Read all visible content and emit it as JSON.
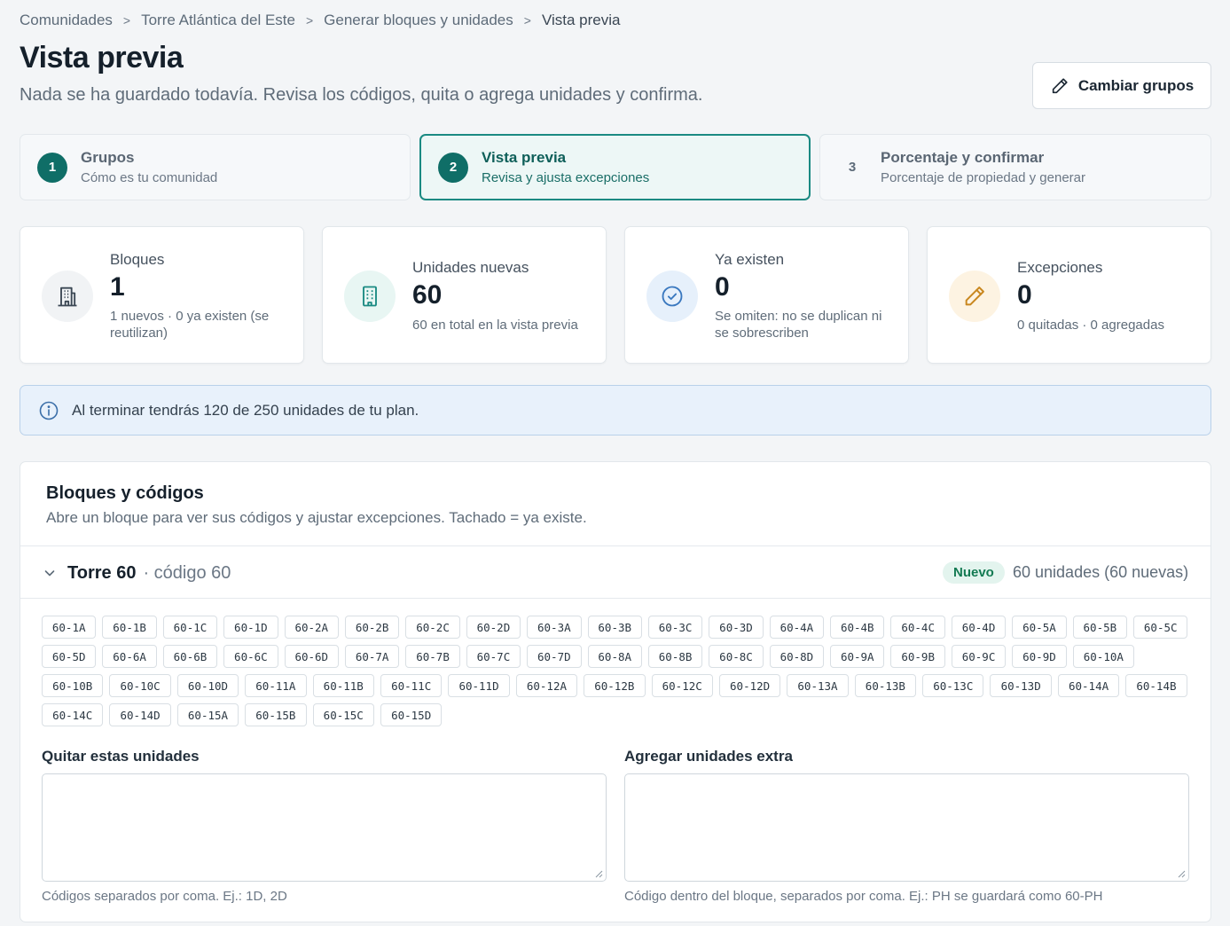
{
  "breadcrumb": [
    "Comunidades",
    "Torre Atlántica del Este",
    "Generar bloques y unidades",
    "Vista previa"
  ],
  "header": {
    "title": "Vista previa",
    "subtitle": "Nada se ha guardado todavía. Revisa los códigos, quita o agrega unidades y confirma.",
    "change_groups_label": "Cambiar grupos"
  },
  "steps": [
    {
      "num": "1",
      "title": "Grupos",
      "sub": "Cómo es tu comunidad"
    },
    {
      "num": "2",
      "title": "Vista previa",
      "sub": "Revisa y ajusta excepciones"
    },
    {
      "num": "3",
      "title": "Porcentaje y confirmar",
      "sub": "Porcentaje de propiedad y generar"
    }
  ],
  "stats": [
    {
      "label": "Bloques",
      "value": "1",
      "desc": "1 nuevos · 0 ya existen (se reutilizan)",
      "icon": "building-icon"
    },
    {
      "label": "Unidades nuevas",
      "value": "60",
      "desc": "60 en total en la vista previa",
      "icon": "apartment-icon"
    },
    {
      "label": "Ya existen",
      "value": "0",
      "desc": "Se omiten: no se duplican ni se sobrescriben",
      "icon": "check-circle-icon"
    },
    {
      "label": "Excepciones",
      "value": "0",
      "desc": "0 quitadas · 0 agregadas",
      "icon": "pencil-icon"
    }
  ],
  "info_banner": "Al terminar tendrás 120 de 250 unidades de tu plan.",
  "blocks_panel": {
    "title": "Bloques y códigos",
    "subtitle": "Abre un bloque para ver sus códigos y ajustar excepciones. Tachado = ya existe.",
    "block": {
      "name": "Torre 60",
      "code": "· código 60",
      "badge": "Nuevo",
      "units": "60 unidades (60 nuevas)",
      "codes": [
        "60-1A",
        "60-1B",
        "60-1C",
        "60-1D",
        "60-2A",
        "60-2B",
        "60-2C",
        "60-2D",
        "60-3A",
        "60-3B",
        "60-3C",
        "60-3D",
        "60-4A",
        "60-4B",
        "60-4C",
        "60-4D",
        "60-5A",
        "60-5B",
        "60-5C",
        "60-5D",
        "60-6A",
        "60-6B",
        "60-6C",
        "60-6D",
        "60-7A",
        "60-7B",
        "60-7C",
        "60-7D",
        "60-8A",
        "60-8B",
        "60-8C",
        "60-8D",
        "60-9A",
        "60-9B",
        "60-9C",
        "60-9D",
        "60-10A",
        "60-10B",
        "60-10C",
        "60-10D",
        "60-11A",
        "60-11B",
        "60-11C",
        "60-11D",
        "60-12A",
        "60-12B",
        "60-12C",
        "60-12D",
        "60-13A",
        "60-13B",
        "60-13C",
        "60-13D",
        "60-14A",
        "60-14B",
        "60-14C",
        "60-14D",
        "60-15A",
        "60-15B",
        "60-15C",
        "60-15D"
      ]
    },
    "remove_label": "Quitar estas unidades",
    "remove_value": "",
    "remove_help": "Códigos separados por coma. Ej.: 1D, 2D",
    "add_label": "Agregar unidades extra",
    "add_value": "",
    "add_help": "Código dentro del bloque, separados por coma. Ej.: PH se guardará como 60-PH"
  }
}
